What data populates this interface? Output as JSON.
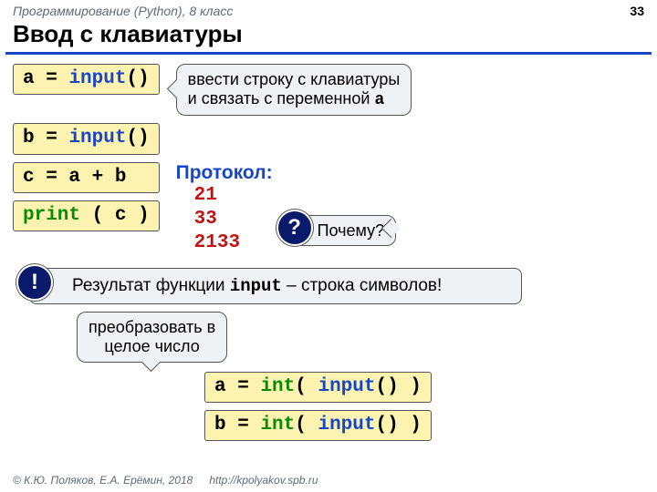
{
  "header": {
    "course": "Программирование (Python), 8 класс",
    "page": "33"
  },
  "title": "Ввод с клавиатуры",
  "code": {
    "l1_a": "a",
    "l1_eq": "=",
    "l1_fn": "input",
    "l1_p": "()",
    "l2_b": "b",
    "l2_eq": "=",
    "l2_fn": "input",
    "l2_p": "()",
    "l3": "c = a + b",
    "l4_fn": "print",
    "l4_args": "( c )",
    "l5_a": "a",
    "l5_eq": "=",
    "l5_int": "int",
    "l5_open": "( ",
    "l5_fn": "input",
    "l5_p": "()",
    " l5_close": " )",
    "l6_b": "b",
    "l6_eq": "=",
    "l6_int": "int",
    "l6_open": "( ",
    "l6_fn": "input",
    "l6_p": "()",
    "l6_close": " )"
  },
  "callout1_a": "ввести строку с клавиатуры",
  "callout1_b": "и связать с переменной ",
  "callout1_var": "a",
  "protocol": {
    "label": "Протокол:",
    "v1": "21",
    "v2": "33",
    "v3": "2133"
  },
  "why": {
    "badge": "?",
    "text": "Почему?"
  },
  "bang": {
    "badge": "!",
    "a": "Результат функции ",
    "fn": "input",
    "b": " – строка символов!"
  },
  "convert": {
    "a": "преобразовать в",
    "b": "целое число"
  },
  "footer": {
    "c": "© К.Ю. Поляков, Е.А. Ерёмин, 2018",
    "u": "http://kpolyakov.spb.ru"
  }
}
